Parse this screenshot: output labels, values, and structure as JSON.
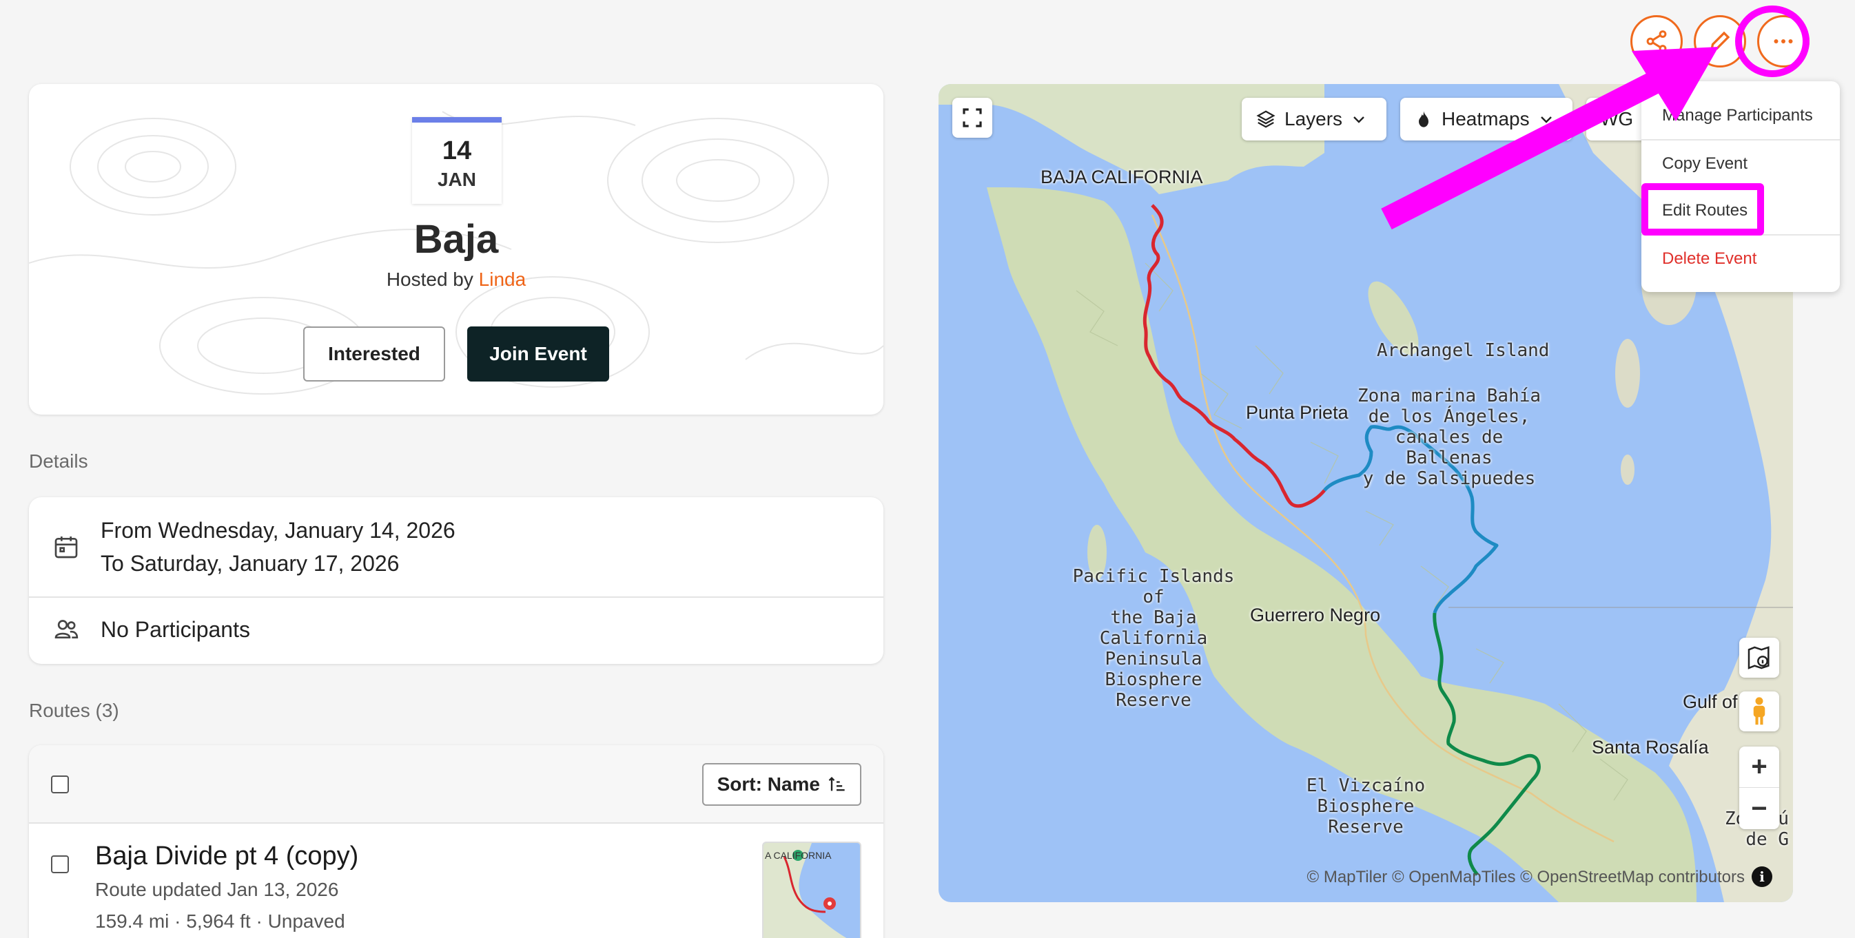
{
  "header": {
    "share_icon": "share-icon",
    "edit_icon": "pencil-icon",
    "more_icon": "ellipsis-icon"
  },
  "event": {
    "date_day": "14",
    "date_month": "JAN",
    "title": "Baja",
    "hosted_prefix": "Hosted by",
    "host": "Linda",
    "interested_label": "Interested",
    "join_label": "Join Event"
  },
  "details": {
    "section_label": "Details",
    "date_from": "From Wednesday, January 14, 2026",
    "date_to": "To Saturday, January 17, 2026",
    "participants": "No Participants"
  },
  "routes": {
    "section_label": "Routes (3)",
    "sort_label": "Sort: Name",
    "items": [
      {
        "name": "Baja Divide pt 4 (copy)",
        "updated": "Route updated Jan 13, 2026",
        "stats": "159.4 mi · 5,964 ft · Unpaved"
      }
    ]
  },
  "map": {
    "layers_label": "Layers",
    "heatmaps_label": "Heatmaps",
    "partial_label": "WG",
    "thumb_label": "A CALIFORNIA",
    "labels": {
      "baja_california": "BAJA CALIFORNIA",
      "archangel": "Archangel Island",
      "zona_marina_1": "Zona marina Bahía",
      "zona_marina_2": "de los Ángeles,",
      "zona_marina_3": "canales de Ballenas",
      "zona_marina_4": "y de Salsipuedes",
      "punta_prieta": "Punta Prieta",
      "pacific_1": "Pacific Islands of",
      "pacific_2": "the Baja California",
      "pacific_3": "Peninsula Biosphere",
      "pacific_4": "Reserve",
      "guerrero": "Guerrero Negro",
      "vizcaino_1": "El Vizcaíno",
      "vizcaino_2": "Biosphere Reserve",
      "santa_rosalia": "Santa Rosalía",
      "gulf": "Gulf of",
      "gulf_r": "r",
      "zona_right_1": "Zo",
      "zona_right_2": "de G",
      "zona_right_3": "ú"
    },
    "attribution": "© MapTiler © OpenMapTiles © OpenStreetMap contributors",
    "route_colors": [
      "#d9262f",
      "#1e8bc3",
      "#0f8a4a"
    ]
  },
  "menu": {
    "items": [
      "Manage Participants",
      "Copy Event",
      "Edit Routes",
      "Delete Event"
    ]
  },
  "colors": {
    "accent": "#f06a1d",
    "annotation": "#ff00ff",
    "dark_button": "#0e2326",
    "danger": "#e0302b"
  }
}
